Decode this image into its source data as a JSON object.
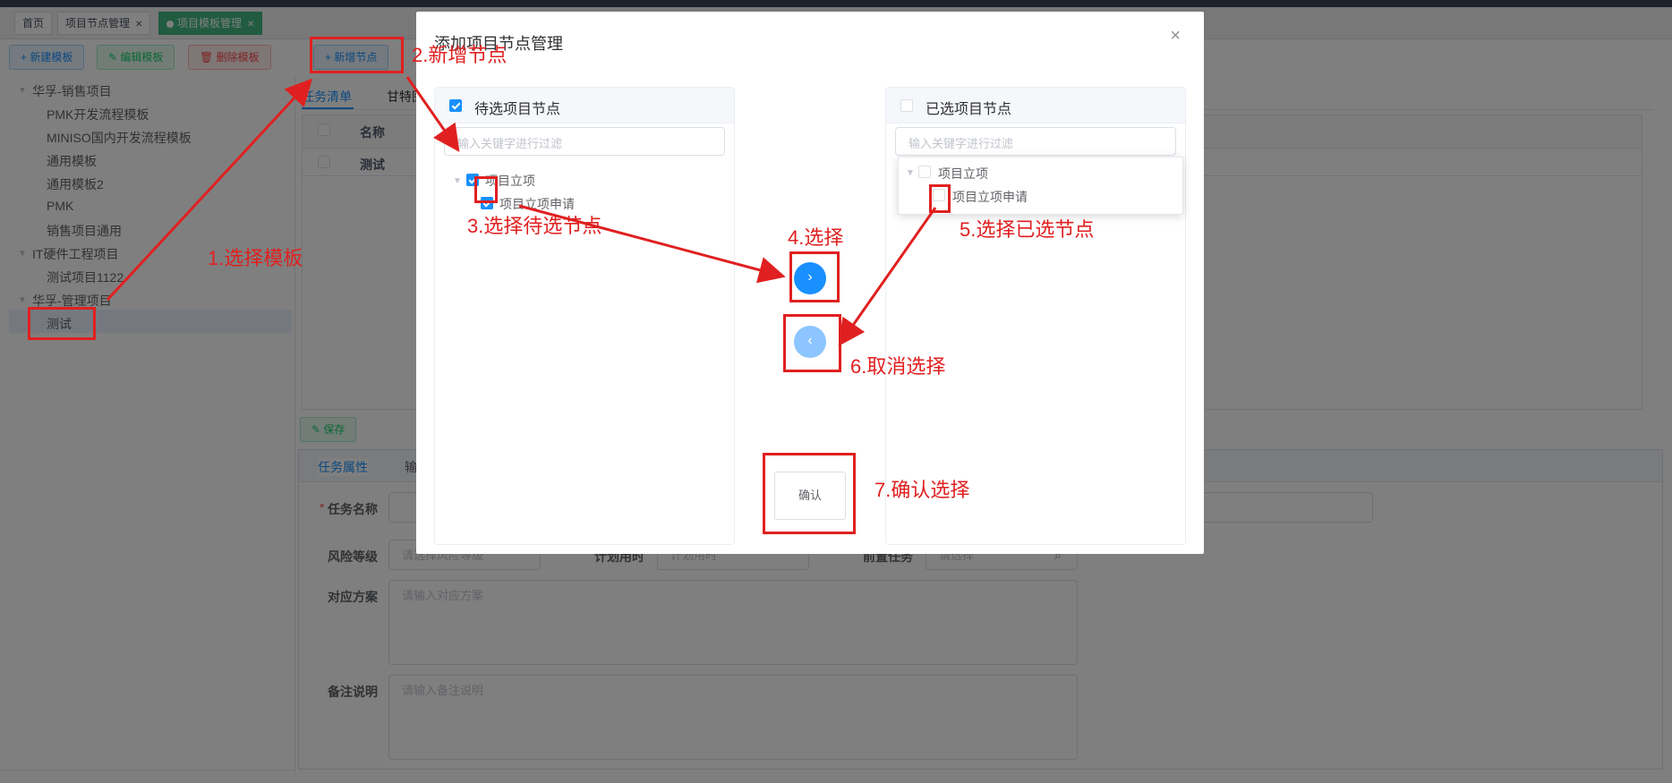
{
  "tabs": [
    {
      "label": "首页",
      "closable": false,
      "active": false
    },
    {
      "label": "项目节点管理",
      "closable": true,
      "active": false
    },
    {
      "label": "项目模板管理",
      "closable": true,
      "active": true
    }
  ],
  "toolbar": {
    "new_template": "+ 新建模板",
    "edit_template": "✎ 编辑模板",
    "delete_template": "🗑 删除模板",
    "add_node": "+ 新增节点"
  },
  "tree": {
    "groups": [
      {
        "label": "华孚-销售项目",
        "children": [
          "PMK开发流程模板",
          "MINISO国内开发流程模板",
          "通用模板",
          "通用模板2",
          "PMK",
          "销售项目通用"
        ]
      },
      {
        "label": "IT硬件工程项目",
        "children": [
          "测试项目1122"
        ]
      },
      {
        "label": "华孚-管理项目",
        "children": [
          "测试"
        ]
      }
    ]
  },
  "main": {
    "tabs": [
      "任务清单",
      "甘特图"
    ],
    "table": {
      "header": "名称",
      "rows": [
        "测试"
      ]
    },
    "save": "✎ 保存",
    "form_tabs": [
      "任务属性",
      "输"
    ],
    "fields": {
      "task_name": "任务名称",
      "risk_level": "风险等级",
      "risk_placeholder": "请选择风险等级",
      "plan_time": "计划用时",
      "plan_placeholder": "计划用时",
      "pre_task": "前置任务",
      "pre_placeholder": "请选择",
      "plan_label": "对应方案",
      "plan_text_placeholder": "请输入对应方案",
      "remark": "备注说明",
      "remark_placeholder": "请输入备注说明"
    }
  },
  "dialog": {
    "title": "添加项目节点管理",
    "close": "×",
    "left_panel": {
      "title": "待选项目节点",
      "filter_placeholder": "输入关键字进行过滤",
      "parent": "项目立项",
      "child": "项目立项申请"
    },
    "right_panel": {
      "title": "已选项目节点",
      "filter_placeholder": "输入关键字进行过滤",
      "parent": "项目立项",
      "child": "项目立项申请"
    },
    "move_right": "›",
    "move_left": "‹",
    "confirm": "确认"
  },
  "annotations": {
    "a1": "1.选择模板",
    "a2": "2.新增节点",
    "a3": "3.选择待选节点",
    "a4": "4.选择",
    "a5": "5.选择已选节点",
    "a6": "6.取消选择",
    "a7": "7.确认选择"
  }
}
